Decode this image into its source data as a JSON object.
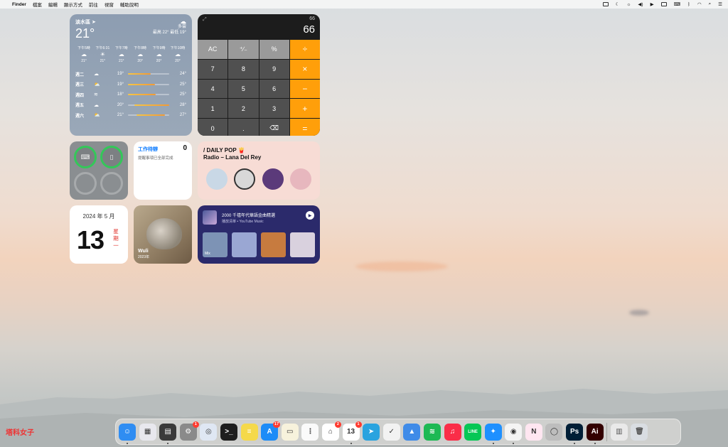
{
  "menubar": {
    "app": "Finder",
    "items": [
      "檔案",
      "編輯",
      "顯示方式",
      "前往",
      "視窗",
      "輔助說明"
    ]
  },
  "weather": {
    "location": "淡水區",
    "temp": "21°",
    "condition": "多雲",
    "hilo": "最高 22° 最低 19°",
    "hours": [
      {
        "time": "下午5時",
        "icon": "☁",
        "temp": "21°"
      },
      {
        "time": "下午6:31",
        "icon": "☀",
        "temp": "21°"
      },
      {
        "time": "下午7時",
        "icon": "☁",
        "temp": "21°"
      },
      {
        "time": "下午8時",
        "icon": "☁",
        "temp": "20°"
      },
      {
        "time": "下午9時",
        "icon": "☁",
        "temp": "20°"
      },
      {
        "time": "下午10時",
        "icon": "☁",
        "temp": "20°"
      }
    ],
    "days": [
      {
        "day": "週二",
        "icon": "☁",
        "low": "19°",
        "high": "24°",
        "from": 0.0,
        "to": 0.55
      },
      {
        "day": "週三",
        "icon": "⛅",
        "low": "19°",
        "high": "25°",
        "from": 0.0,
        "to": 0.65
      },
      {
        "day": "週四",
        "icon": "≋",
        "low": "18°",
        "high": "25°",
        "from": 0.0,
        "to": 0.68
      },
      {
        "day": "週五",
        "icon": "☁",
        "low": "20°",
        "high": "28°",
        "from": 0.15,
        "to": 1.0
      },
      {
        "day": "週六",
        "icon": "⛅",
        "low": "21°",
        "high": "27°",
        "from": 0.2,
        "to": 0.9
      }
    ]
  },
  "calculator": {
    "expand": "⤢",
    "history": "66",
    "display": "66",
    "keys": [
      {
        "label": "AC",
        "type": "fn"
      },
      {
        "label": "⁺∕₋",
        "type": "fn"
      },
      {
        "label": "%",
        "type": "fn"
      },
      {
        "label": "÷",
        "type": "op"
      },
      {
        "label": "7",
        "type": "num"
      },
      {
        "label": "8",
        "type": "num"
      },
      {
        "label": "9",
        "type": "num"
      },
      {
        "label": "×",
        "type": "op"
      },
      {
        "label": "4",
        "type": "num"
      },
      {
        "label": "5",
        "type": "num"
      },
      {
        "label": "6",
        "type": "num"
      },
      {
        "label": "−",
        "type": "op"
      },
      {
        "label": "1",
        "type": "num"
      },
      {
        "label": "2",
        "type": "num"
      },
      {
        "label": "3",
        "type": "num"
      },
      {
        "label": "+",
        "type": "op"
      },
      {
        "label": "0",
        "type": "num"
      },
      {
        "label": ".",
        "type": "num"
      },
      {
        "label": "⌫",
        "type": "num"
      },
      {
        "label": "=",
        "type": "op"
      }
    ]
  },
  "battery": {
    "devices": [
      {
        "icon": "⌨",
        "full": true
      },
      {
        "icon": "▯",
        "full": true
      },
      {
        "icon": "",
        "full": false
      },
      {
        "icon": "",
        "full": false
      }
    ]
  },
  "reminders": {
    "title": "工作待辦",
    "count": "0",
    "status": "提醒事項已全部完成"
  },
  "music": {
    "line1": "/ DAILY POP 🍟",
    "line2": "Radio – Lana Del Rey",
    "albums": [
      "#c9d8e6",
      "#d8d8d8",
      "#5b3a7a",
      "#e7b7be"
    ]
  },
  "calendar": {
    "month": "2024 年 5 月",
    "day": "13",
    "weekday": "星期一"
  },
  "photo": {
    "title": "Wuli",
    "year": "2023年"
  },
  "ytmusic": {
    "title": "2000 千禧年代華語金曲精選",
    "subtitle": "播放清單 • YouTube Music",
    "tiles": [
      {
        "label": "Mix",
        "color": "#7d93b5"
      },
      {
        "label": "",
        "color": "#9aa7d3"
      },
      {
        "label": "",
        "color": "#c77b3f"
      },
      {
        "label": "",
        "color": "#d9d1de"
      }
    ]
  },
  "dock": {
    "apps": [
      {
        "name": "finder",
        "color": "#2f8df2",
        "glyph": "☺",
        "badge": "",
        "running": true
      },
      {
        "name": "launchpad",
        "color": "#e8e8ee",
        "glyph": "▦",
        "badge": "",
        "running": false
      },
      {
        "name": "calculator",
        "color": "#3a3a3a",
        "glyph": "▤",
        "badge": "",
        "running": true
      },
      {
        "name": "system-settings",
        "color": "#8a8a8a",
        "glyph": "⚙",
        "badge": "1",
        "running": false
      },
      {
        "name": "airdrop",
        "color": "#dfe7f3",
        "glyph": "◎",
        "badge": "",
        "running": false
      },
      {
        "name": "terminal",
        "color": "#1e1e1e",
        "glyph": ">_",
        "badge": "",
        "running": false
      },
      {
        "name": "stickies",
        "color": "#f5d94a",
        "glyph": "≡",
        "badge": "",
        "running": false
      },
      {
        "name": "app-store",
        "color": "#1d8cf7",
        "glyph": "A",
        "badge": "17",
        "running": false
      },
      {
        "name": "notes",
        "color": "#f7f2dc",
        "glyph": "▭",
        "badge": "",
        "running": false
      },
      {
        "name": "reminders",
        "color": "#fafafa",
        "glyph": "⋮",
        "badge": "",
        "running": false
      },
      {
        "name": "home",
        "color": "#ffffff",
        "glyph": "⌂",
        "badge": "2",
        "running": false
      },
      {
        "name": "calendar",
        "color": "#ffffff",
        "glyph": "13",
        "badge": "1",
        "running": true
      },
      {
        "name": "telegram",
        "color": "#2aa3df",
        "glyph": "➤",
        "badge": "",
        "running": false
      },
      {
        "name": "ticktick",
        "color": "#f2f2f2",
        "glyph": "✓",
        "badge": "",
        "running": false
      },
      {
        "name": "surfshark",
        "color": "#3f8be8",
        "glyph": "▲",
        "badge": "",
        "running": false
      },
      {
        "name": "spotify",
        "color": "#1db954",
        "glyph": "≋",
        "badge": "",
        "running": false
      },
      {
        "name": "music",
        "color": "#fa2d48",
        "glyph": "♫",
        "badge": "",
        "running": false
      },
      {
        "name": "line",
        "color": "#06c755",
        "glyph": "LINE",
        "badge": "",
        "running": false
      },
      {
        "name": "safari",
        "color": "#1e90ff",
        "glyph": "✦",
        "badge": "",
        "running": true
      },
      {
        "name": "chrome",
        "color": "#f4f4f4",
        "glyph": "◉",
        "badge": "",
        "running": true
      },
      {
        "name": "notion",
        "color": "#ffe6f1",
        "glyph": "N",
        "badge": "",
        "running": false
      },
      {
        "name": "screenshot",
        "color": "#bdbdbd",
        "glyph": "◯",
        "badge": "",
        "running": false
      },
      {
        "name": "photoshop",
        "color": "#001e36",
        "glyph": "Ps",
        "badge": "",
        "running": true
      },
      {
        "name": "illustrator",
        "color": "#330000",
        "glyph": "Ai",
        "badge": "",
        "running": true
      }
    ],
    "extras": [
      {
        "name": "downloads-stack",
        "color": "#e9e9e9",
        "glyph": "▥"
      },
      {
        "name": "trash",
        "color": "#d9dde2",
        "glyph": "🗑"
      }
    ]
  },
  "watermark": "塔科女子"
}
